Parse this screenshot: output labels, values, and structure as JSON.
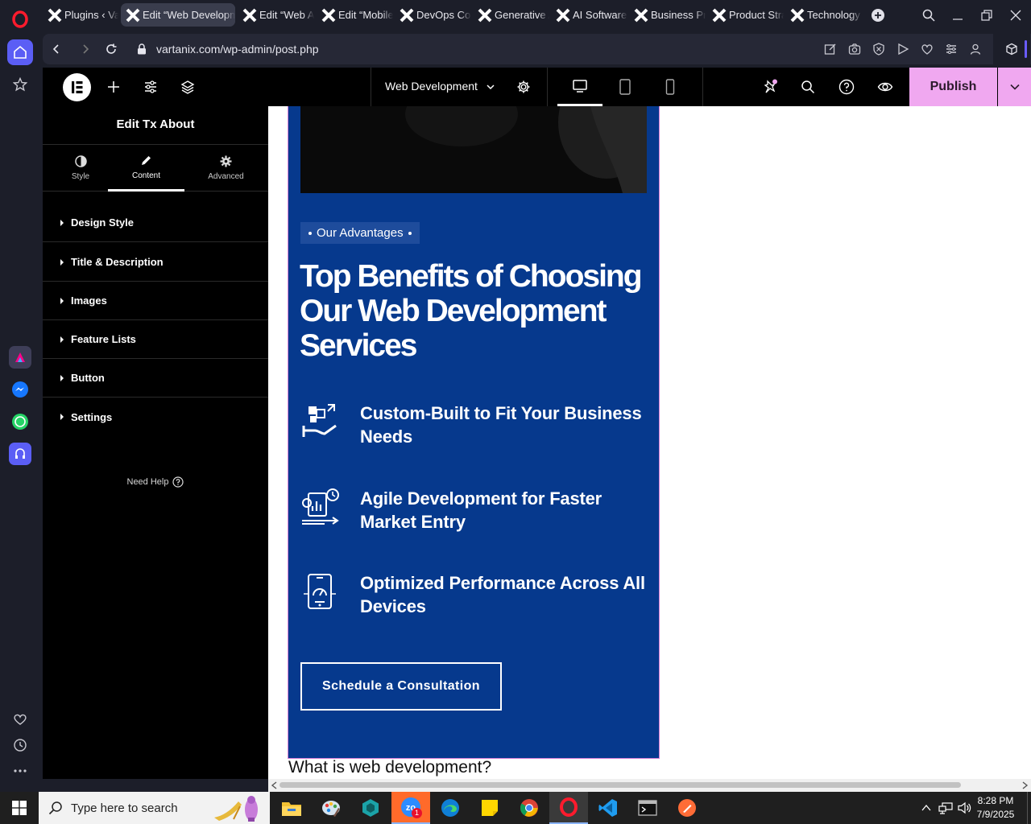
{
  "browser": {
    "tabs": [
      {
        "label": "Plugins ‹ Vartanix",
        "active": false
      },
      {
        "label": "Edit “Web Development”",
        "active": true
      },
      {
        "label": "Edit “Web Apps”",
        "active": false
      },
      {
        "label": "Edit “Mobile”",
        "active": false
      },
      {
        "label": "DevOps Consulting",
        "active": false
      },
      {
        "label": "Generative AI",
        "active": false
      },
      {
        "label": "AI Software",
        "active": false
      },
      {
        "label": "Business Process",
        "active": false
      },
      {
        "label": "Product Strategy",
        "active": false
      },
      {
        "label": "Technology Solutions",
        "active": false
      }
    ],
    "url": "vartanix.com/wp-admin/post.php"
  },
  "editor": {
    "page_name": "Web Development",
    "publish_label": "Publish",
    "panel": {
      "title": "Edit Tx About",
      "tabs": [
        {
          "label": "Style",
          "active": false
        },
        {
          "label": "Content",
          "active": true
        },
        {
          "label": "Advanced",
          "active": false
        }
      ],
      "sections": [
        "Design Style",
        "Title & Description",
        "Images",
        "Feature Lists",
        "Button",
        "Settings"
      ],
      "need_help": "Need Help"
    }
  },
  "canvas": {
    "badge": "Our Advantages",
    "heading": "Top Benefits of Choosing Our Web Development Services",
    "features": [
      {
        "title": "Custom-Built to Fit Your Business Needs",
        "icon": "puzzle-hand-icon"
      },
      {
        "title": "Agile Development for Faster Market Entry",
        "icon": "agile-report-icon"
      },
      {
        "title": "Optimized Performance Across All Devices",
        "icon": "performance-gauge-icon"
      }
    ],
    "cta_label": "Schedule a Consultation",
    "next_heading": "What is web development?",
    "colors": {
      "section_bg": "#06398d",
      "publish_bg": "#f0a8f0"
    }
  },
  "taskbar": {
    "search_placeholder": "Type here to search",
    "time": "8:28 PM",
    "date": "7/9/2025",
    "zoom_badge": "1"
  }
}
